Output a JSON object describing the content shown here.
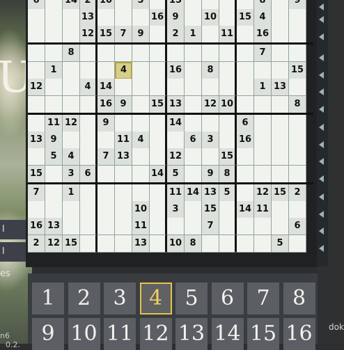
{
  "background": {
    "left_letter": "U",
    "left_fragments": [
      "l",
      "l"
    ],
    "left_es": "es",
    "left_bottom": "n6",
    "left_bottom2": "0.2.",
    "right_bottom": "dok"
  },
  "board": {
    "size": 16,
    "visible_rows": [
      [
        "6",
        "",
        "14",
        "2",
        "10",
        "",
        "5",
        "",
        "15",
        "",
        "",
        "",
        "",
        "8",
        "",
        "9"
      ],
      [
        "",
        "",
        "",
        "13",
        "",
        "",
        "",
        "16",
        "9",
        "",
        "10",
        "",
        "15",
        "4",
        "",
        ""
      ],
      [
        "",
        "",
        "",
        "12",
        "15",
        "7",
        "9",
        "",
        "2",
        "1",
        "",
        "11",
        "",
        "16",
        "",
        ""
      ],
      [
        "",
        "",
        "8",
        "",
        "",
        "",
        "",
        "",
        "",
        "",
        "",
        "",
        "",
        "7",
        "",
        ""
      ],
      [
        "",
        "1",
        "",
        "",
        "",
        "4",
        "",
        "",
        "16",
        "",
        "8",
        "",
        "",
        "",
        "",
        "15"
      ],
      [
        "12",
        "",
        "",
        "4",
        "14",
        "",
        "",
        "",
        "",
        "",
        "",
        "",
        "",
        "1",
        "13",
        ""
      ],
      [
        "",
        "",
        "",
        "",
        "16",
        "9",
        "",
        "15",
        "13",
        "",
        "12",
        "10",
        "",
        "",
        "",
        "8"
      ],
      [
        "",
        "11",
        "12",
        "",
        "9",
        "",
        "",
        "",
        "14",
        "",
        "",
        "",
        "6",
        "",
        "",
        ""
      ],
      [
        "13",
        "9",
        "",
        "",
        "",
        "11",
        "4",
        "",
        "",
        "6",
        "3",
        "",
        "16",
        "",
        "",
        ""
      ],
      [
        "",
        "5",
        "4",
        "",
        "7",
        "13",
        "",
        "",
        "12",
        "",
        "",
        "15",
        "",
        "",
        "",
        ""
      ],
      [
        "15",
        "",
        "3",
        "6",
        "",
        "",
        "",
        "14",
        "5",
        "",
        "9",
        "8",
        "",
        "",
        "",
        ""
      ],
      [
        "7",
        "",
        "1",
        "",
        "",
        "",
        "",
        "",
        "11",
        "14",
        "13",
        "5",
        "",
        "12",
        "15",
        "2"
      ],
      [
        "",
        "",
        "",
        "",
        "",
        "",
        "10",
        "",
        "3",
        "",
        "15",
        "",
        "14",
        "11",
        "",
        ""
      ],
      [
        "16",
        "13",
        "",
        "",
        "",
        "",
        "11",
        "",
        "",
        "",
        "7",
        "",
        "",
        "",
        "",
        "6"
      ],
      [
        "2",
        "12",
        "15",
        "",
        "",
        "",
        "13",
        "",
        "10",
        "8",
        "",
        "",
        "",
        "",
        "5",
        ""
      ]
    ],
    "selected_value": "4"
  },
  "pad": {
    "keys": [
      "1",
      "2",
      "3",
      "4",
      "5",
      "6",
      "7",
      "8",
      "9",
      "10",
      "11",
      "12",
      "13",
      "14",
      "15",
      "16"
    ],
    "active_key": "4"
  },
  "colors": {
    "cell_bg": "#f1f4ee",
    "given_bg": "#dde1db",
    "selected_bg": "#d6cf8a",
    "pad_key_bg": "#5b5e62",
    "pad_active_border": "#e6c34a"
  }
}
